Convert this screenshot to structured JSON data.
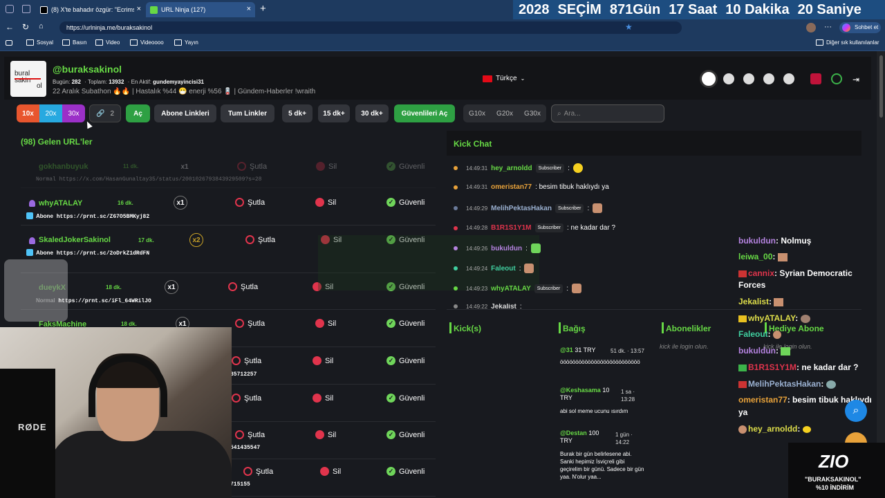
{
  "browser": {
    "tabs": [
      {
        "title": "(8) X'te bahadır özgür: \"Ecrimsil cə"
      },
      {
        "title": "URL Ninja (127)"
      }
    ],
    "new_tab": "+",
    "url": "https://urlninja.me/buraksakinol",
    "profile_label": "Sohbet et",
    "bookmarks": [
      "Sosyal",
      "Basın",
      "Video",
      "Videoooo",
      "Yayın"
    ],
    "other_bookmarks": "Diğer sık kullanılanlar"
  },
  "countdown": {
    "year": "2028",
    "label": "SEÇİM",
    "days": "871",
    "days_unit": "Gün",
    "hours": "17",
    "hours_unit": "Saat",
    "minutes": "10",
    "minutes_unit": "Dakika",
    "seconds": "20",
    "seconds_unit": "Saniye"
  },
  "header": {
    "logo_text_1": "bural",
    "logo_text_2": "sakin",
    "logo_text_3": "ol",
    "username": "@buraksakinol",
    "today_label": "Bugün:",
    "today_value": "282",
    "total_label": "Toplam:",
    "total_value": "13932",
    "active_label": "En Aktif:",
    "active_value": "gundemyayincisi31",
    "status_line": "22 Aralık Subathon 🔥🔥 | Hastalık %44 😷 enerji %56 🪫 | Gündem-Haberler !wraith",
    "language": "Türkçe"
  },
  "toolbar": {
    "mult_10": "10x",
    "mult_20": "20x",
    "mult_30": "30x",
    "link_count": "2",
    "open": "Aç",
    "subscriber_links": "Abone Linkleri",
    "all_links": "Tum Linkler",
    "k5": "5 dk+",
    "k15": "15 dk+",
    "k30": "30 dk+",
    "open_safe": "Güvenlileri Aç",
    "g10": "G10x",
    "g20": "G20x",
    "g30": "G30x",
    "search_placeholder": "Ara..."
  },
  "urls": {
    "heading": "(98) Gelen URL'ler",
    "ban": "Şutla",
    "delete": "Sil",
    "safe": "Güvenli",
    "rows": [
      {
        "user": "gokhanbuyuk",
        "time": "11 dk.",
        "mult": "x1",
        "type": "Normal",
        "link": "https://x.com/HasanGunaltay35/status/2001026793843929509?s=28"
      },
      {
        "user": "whyATALAY",
        "time": "16 dk.",
        "mult": "x1",
        "type": "Abone",
        "link": "https://prnt.sc/Z67O5BMKyj82"
      },
      {
        "user": "SkaledJokerSakinol",
        "time": "17 dk.",
        "mult": "x2",
        "type": "Abone",
        "link": "https://prnt.sc/2oDrkZ1dRdFN"
      },
      {
        "user": "dueykX",
        "time": "18 dk.",
        "mult": "x1",
        "type": "Normal",
        "link": "https://prnt.sc/iFl_64WRilJO"
      },
      {
        "user": "FaksMachine",
        "time": "18 dk.",
        "mult": "x1",
        "type": "",
        "link": ""
      },
      {
        "link_tail": "35712257"
      },
      {
        "link_tail": ""
      },
      {
        "link_tail": "541435547"
      },
      {
        "link_tail": "715155"
      }
    ]
  },
  "chat": {
    "title": "Kick Chat",
    "subscriber": "Subscriber",
    "messages": [
      {
        "time": "14:49:31",
        "user": "hey_arnoldd",
        "sub": true,
        "text": ":",
        "dot": "#e8a23a"
      },
      {
        "time": "14:49:31",
        "user": "omeristan77",
        "sub": false,
        "text": ": besim tibuk haklıydı ya",
        "dot": "#e8a23a"
      },
      {
        "time": "14:49:29",
        "user": "MelihPektasHakan",
        "sub": true,
        "text": ":",
        "dot": "#6a7a9a"
      },
      {
        "time": "14:49:28",
        "user": "B1R1S1Y1M",
        "sub": true,
        "text": ": ne kadar dar ?",
        "dot": "#e0344c"
      },
      {
        "time": "14:49:26",
        "user": "bukuldun",
        "sub": false,
        "text": ":",
        "dot": "#b583e0"
      },
      {
        "time": "14:49:24",
        "user": "Faleout",
        "sub": false,
        "text": ":",
        "dot": "#40d0a0"
      },
      {
        "time": "14:49:23",
        "user": "whyATALAY",
        "sub": true,
        "text": ":",
        "dot": "#67d945"
      },
      {
        "time": "14:49:22",
        "user": "Jekalist",
        "sub": false,
        "text": ":",
        "dot": "#888888"
      }
    ],
    "overlay": [
      {
        "user": "bukuldun",
        "text": "Nolmuş"
      },
      {
        "user": "leiwa_00",
        "text": ""
      },
      {
        "user": "cannix",
        "text": "Syrian Democratic"
      },
      {
        "user": "",
        "text": "Forces"
      },
      {
        "user": "Jekalist",
        "text": ""
      },
      {
        "user": "whyATALAY",
        "text": ""
      },
      {
        "user": "Faleout",
        "text": ""
      },
      {
        "user": "bukuldun",
        "text": ""
      },
      {
        "user": "B1R1S1Y1M",
        "text": "ne kadar dar ?"
      },
      {
        "user": "MelihPektasHakan",
        "text": ""
      },
      {
        "user": "omeristan77",
        "text": "besim tibuk haklıydı"
      },
      {
        "user": "",
        "text": "ya"
      },
      {
        "user": "hey_arnoldd",
        "text": ""
      }
    ]
  },
  "sections": {
    "kicks": "Kick(s)",
    "donations": "Bağış",
    "subs": "Abonelikler",
    "gift_sub": "Hediye Abone",
    "login_hint": "kick ile login olun.",
    "login_hint_2": "kick ile login olun.",
    "donation_rows": [
      {
        "user": "@31",
        "amount": "31 TRY",
        "ago": "51 dk. · 13:57",
        "msg": "öööööööööööööööööööööööööö"
      },
      {
        "user": "@Keshasama",
        "amount": "10 TRY",
        "ago": "1 sa · 13:28",
        "msg": "abi sol meme ucunu ısırdım"
      },
      {
        "user": "@Destan",
        "amount": "100 TRY",
        "ago": "1 gün · 14:22",
        "msg": "Burak bir gün belirlesene abi. Sanki hepimiz İsviçreli gibi geçirelim bir günü. Sadece bir gün yaa. N'olur yaa..."
      }
    ]
  },
  "promo": {
    "brand": "ZIO",
    "line1": "\"BURAKSAKINOL\"",
    "line2": "%10 İNDİRİM"
  },
  "webcam": {
    "mic_brand": "RØDE"
  },
  "colors": {
    "accent": "#67d945",
    "danger": "#e0344c",
    "safe": "#6fd55a",
    "chrome": "#1e3a5f"
  }
}
